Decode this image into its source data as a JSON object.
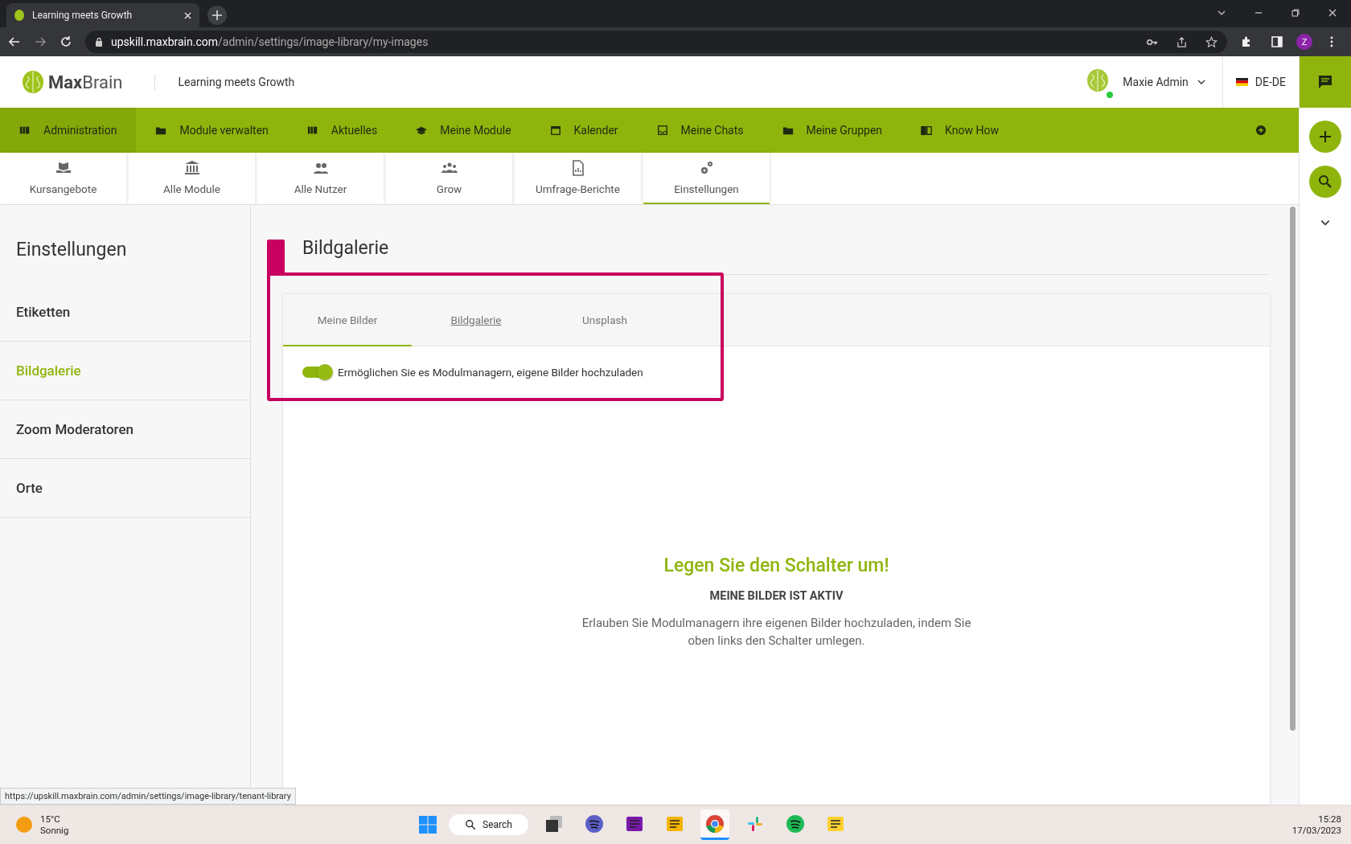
{
  "browser": {
    "tab_title": "Learning meets Growth",
    "url_host": "upskill.maxbrain.com",
    "url_path": "/admin/settings/image-library/my-images",
    "profile_initial": "Z"
  },
  "header": {
    "logo_bold": "Max",
    "logo_light": "Brain",
    "tagline": "Learning meets Growth",
    "user_name": "Maxie Admin",
    "online": true,
    "language": "DE-DE"
  },
  "nav": [
    {
      "label": "Administration",
      "kind": "library",
      "selected": true
    },
    {
      "label": "Module verwalten",
      "kind": "folder",
      "selected": false
    },
    {
      "label": "Aktuelles",
      "kind": "library",
      "selected": false
    },
    {
      "label": "Meine Module",
      "kind": "cap",
      "selected": false
    },
    {
      "label": "Kalender",
      "kind": "calendar",
      "selected": false
    },
    {
      "label": "Meine Chats",
      "kind": "inbox",
      "selected": false
    },
    {
      "label": "Meine Gruppen",
      "kind": "folder",
      "selected": false
    },
    {
      "label": "Know How",
      "kind": "book",
      "selected": false
    }
  ],
  "subnav": [
    {
      "label": "Kursangebote",
      "kind": "hand",
      "selected": false
    },
    {
      "label": "Alle Module",
      "kind": "bank",
      "selected": false
    },
    {
      "label": "Alle Nutzer",
      "kind": "people",
      "selected": false
    },
    {
      "label": "Grow",
      "kind": "group",
      "selected": false
    },
    {
      "label": "Umfrage-Berichte",
      "kind": "report",
      "selected": false
    },
    {
      "label": "Einstellungen",
      "kind": "gears",
      "selected": true
    }
  ],
  "sidebar": {
    "title": "Einstellungen",
    "items": [
      {
        "label": "Etiketten",
        "selected": false
      },
      {
        "label": "Bildgalerie",
        "selected": true
      },
      {
        "label": "Zoom Moderatoren",
        "selected": false
      },
      {
        "label": "Orte",
        "selected": false
      }
    ]
  },
  "page": {
    "title": "Bildgalerie",
    "tabs": [
      {
        "label": "Meine Bilder",
        "selected": true,
        "hovered": false
      },
      {
        "label": "Bildgalerie",
        "selected": false,
        "hovered": true
      },
      {
        "label": "Unsplash",
        "selected": false,
        "hovered": false
      }
    ],
    "toggle": {
      "label": "Ermöglichen Sie es Modulmanagern, eigene Bilder hochzuladen",
      "on": true
    },
    "empty_state": {
      "heading": "Legen Sie den Schalter um!",
      "status": "MEINE BILDER IST AKTIV",
      "description": "Erlauben Sie Modulmanagern ihre eigenen Bilder hochzuladen, indem Sie oben links den Schalter umlegen."
    }
  },
  "status_url": "https://upskill.maxbrain.com/admin/settings/image-library/tenant-library",
  "taskbar": {
    "temperature": "15°C",
    "weather": "Sonnig",
    "search": "Search",
    "time": "15:28",
    "date": "17/03/2023",
    "apps": [
      {
        "kind": "taskview",
        "selected": false
      },
      {
        "kind": "teams",
        "selected": false
      },
      {
        "kind": "onenote",
        "selected": false
      },
      {
        "kind": "files",
        "selected": false
      },
      {
        "kind": "chrome",
        "selected": true
      },
      {
        "kind": "slack",
        "selected": false
      },
      {
        "kind": "spotify",
        "selected": false
      },
      {
        "kind": "miro",
        "selected": false
      }
    ]
  }
}
